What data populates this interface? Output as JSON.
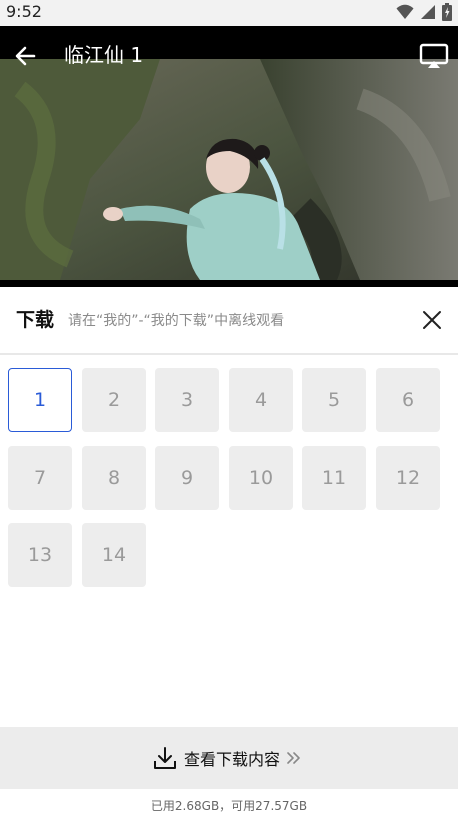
{
  "status_bar": {
    "time": "9:52"
  },
  "player": {
    "title": "临江仙 1"
  },
  "download_sheet": {
    "title": "下载",
    "hint": "请在“我的”-“我的下载”中离线观看",
    "episodes": [
      {
        "label": "1",
        "selected": true
      },
      {
        "label": "2",
        "selected": false
      },
      {
        "label": "3",
        "selected": false
      },
      {
        "label": "4",
        "selected": false
      },
      {
        "label": "5",
        "selected": false
      },
      {
        "label": "6",
        "selected": false
      },
      {
        "label": "7",
        "selected": false
      },
      {
        "label": "8",
        "selected": false
      },
      {
        "label": "9",
        "selected": false
      },
      {
        "label": "10",
        "selected": false
      },
      {
        "label": "11",
        "selected": false
      },
      {
        "label": "12",
        "selected": false
      },
      {
        "label": "13",
        "selected": false
      },
      {
        "label": "14",
        "selected": false
      }
    ],
    "view_downloads_label": "查看下载内容",
    "storage_text": "已用2.68GB，可用27.57GB"
  },
  "icons": {
    "back": "arrow-left-icon",
    "cast": "cast-screen-icon",
    "close": "close-icon",
    "download": "download-icon",
    "chevrons": "double-chevron-right-icon"
  },
  "colors": {
    "accent": "#2a5bd7",
    "tile_bg": "#ededed",
    "tile_text": "#9a9a9a"
  }
}
